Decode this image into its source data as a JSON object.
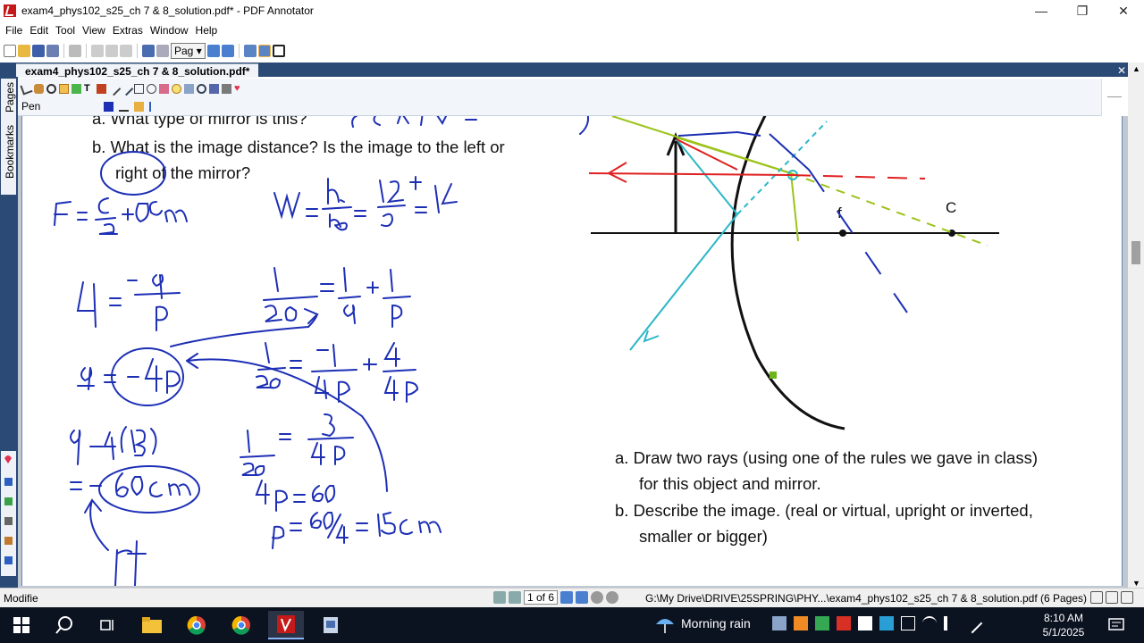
{
  "window": {
    "title": "exam4_phys102_s25_ch 7 & 8_solution.pdf* - PDF Annotator",
    "minimize": "—",
    "restore": "❐",
    "close": "✕"
  },
  "menu": [
    "File",
    "Edit",
    "Tool",
    "View",
    "Extras",
    "Window",
    "Help"
  ],
  "toolbar": {
    "page_dropdown": "Pag"
  },
  "doc_tab": {
    "title": "exam4_phys102_s25_ch 7 & 8_solution.pdf*",
    "close": "✕"
  },
  "side_tabs": {
    "pages": "Pages",
    "bookmarks": "Bookmarks"
  },
  "annot_bar": {
    "tool_name": "Pen"
  },
  "document": {
    "q_a_top": "a.  What type of mirror is this?",
    "q_b_line1": "b.  What is the image distance? Is the image to the left or",
    "q_b_line2": "right of the mirror?",
    "point_f": "f",
    "point_c": "C",
    "ask_a_line1": "a.  Draw two rays (using one of the rules we gave in class)",
    "ask_a_line2": "for this object and mirror.",
    "ask_b_line1": "b.  Describe the image. (real or virtual, upright or inverted,",
    "ask_b_line2": "smaller or bigger)"
  },
  "status": {
    "mode": "Modifie",
    "page_of": "1 of 6",
    "path": "G:\\My Drive\\DRIVE\\25SPRING\\PHY...\\exam4_phys102_s25_ch 7 & 8_solution.pdf (6 Pages)"
  },
  "taskbar": {
    "weather": "Morning rain",
    "time": "8:10 AM",
    "date": "5/1/2025"
  },
  "colors": {
    "ink_blue": "#1d2fb5",
    "ink_red": "#e02020",
    "ink_cyan": "#2bb6c8",
    "ink_green": "#9cc31a",
    "dock": "#2b4a75"
  }
}
